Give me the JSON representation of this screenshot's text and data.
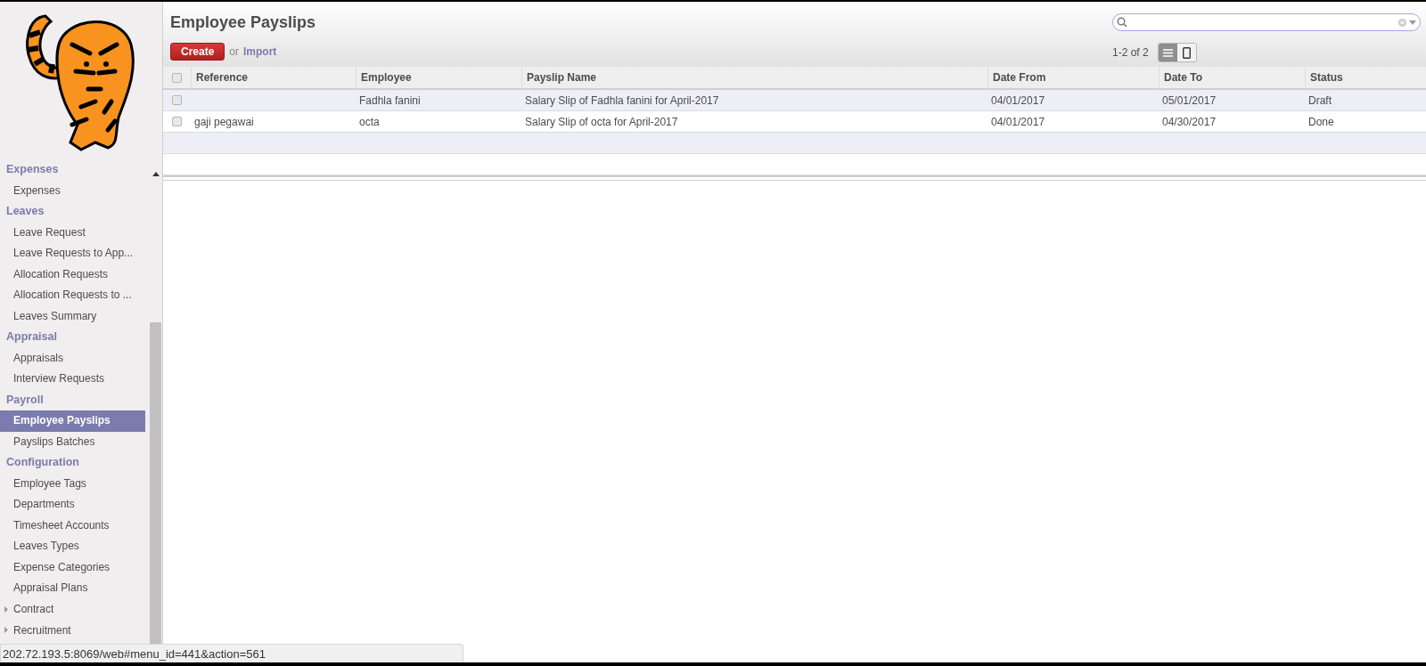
{
  "sidebar": {
    "sections": [
      {
        "title": "Expenses",
        "items": [
          {
            "label": "Expenses",
            "selected": false
          }
        ]
      },
      {
        "title": "Leaves",
        "items": [
          {
            "label": "Leave Request",
            "selected": false
          },
          {
            "label": "Leave Requests to App...",
            "selected": false
          },
          {
            "label": "Allocation Requests",
            "selected": false
          },
          {
            "label": "Allocation Requests to ...",
            "selected": false
          },
          {
            "label": "Leaves Summary",
            "selected": false
          }
        ]
      },
      {
        "title": "Appraisal",
        "items": [
          {
            "label": "Appraisals",
            "selected": false
          },
          {
            "label": "Interview Requests",
            "selected": false
          }
        ]
      },
      {
        "title": "Payroll",
        "items": [
          {
            "label": "Employee Payslips",
            "selected": true
          },
          {
            "label": "Payslips Batches",
            "selected": false
          }
        ]
      },
      {
        "title": "Configuration",
        "items": [
          {
            "label": "Employee Tags",
            "selected": false
          },
          {
            "label": "Departments",
            "selected": false
          },
          {
            "label": "Timesheet Accounts",
            "selected": false
          },
          {
            "label": "Leaves Types",
            "selected": false
          },
          {
            "label": "Expense Categories",
            "selected": false
          },
          {
            "label": "Appraisal Plans",
            "selected": false
          }
        ]
      }
    ],
    "menus": [
      {
        "label": "Contract",
        "expanded": false
      },
      {
        "label": "Recruitment",
        "expanded": false
      }
    ]
  },
  "page": {
    "title": "Employee Payslips",
    "create_button": "Create",
    "or_text": "or",
    "import_link": "Import",
    "pager": "1-2 of 2",
    "views": [
      {
        "kind": "list",
        "selected": true
      },
      {
        "kind": "form",
        "selected": false
      }
    ]
  },
  "table": {
    "header_checked": false,
    "columns": [
      "Reference",
      "Employee",
      "Payslip Name",
      "Date From",
      "Date To",
      "Status"
    ],
    "rows": [
      {
        "checked": false,
        "cells": [
          "",
          "Fadhla fanini",
          "Salary Slip of Fadhla fanini for April-2017",
          "04/01/2017",
          "05/01/2017",
          "Draft"
        ]
      },
      {
        "checked": false,
        "cells": [
          "gaji pegawai",
          "octa",
          "Salary Slip of octa for April-2017",
          "04/01/2017",
          "04/30/2017",
          "Done"
        ]
      }
    ]
  },
  "status_bar": {
    "url": "202.72.193.5:8069/web#menu_id=441&action=561"
  }
}
